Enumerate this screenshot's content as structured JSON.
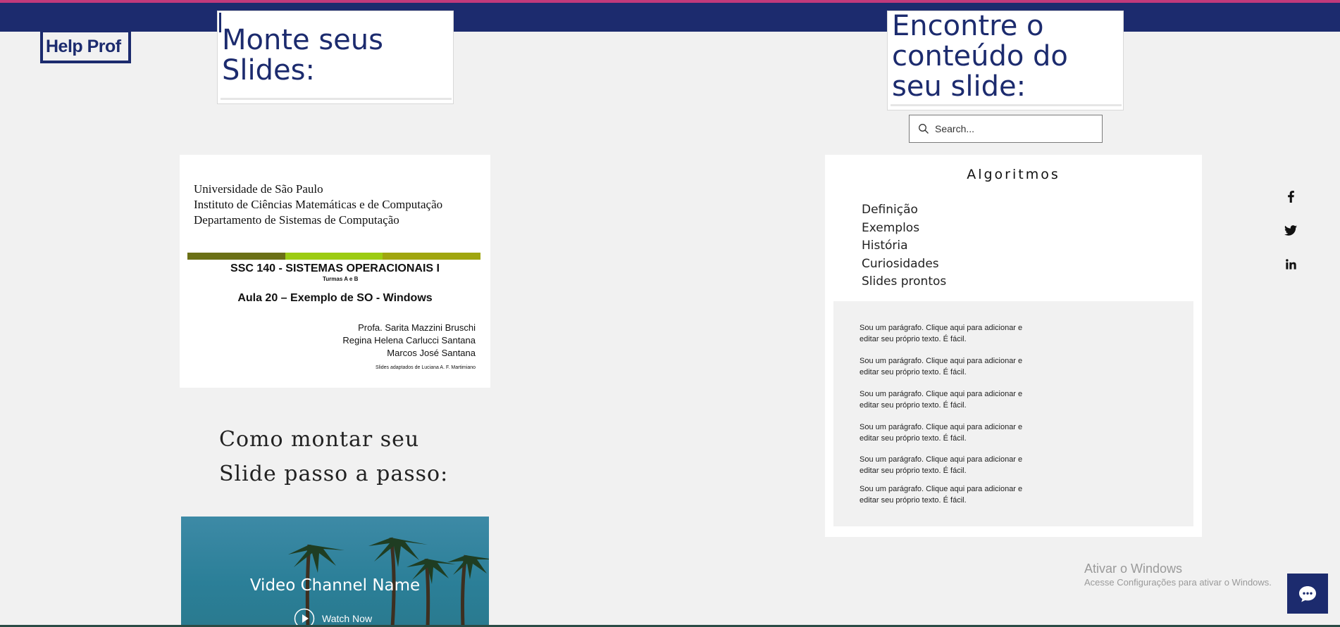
{
  "colors": {
    "brand_navy": "#1c2b6e",
    "accent_pink": "#c13a7b",
    "page_bg": "#f1f1f1"
  },
  "header": {
    "logo_text": "Help Prof"
  },
  "left_title": {
    "text": "Monte seus Slides:"
  },
  "right_title": {
    "text": "Encontre o conteúdo do seu slide:"
  },
  "search": {
    "placeholder": "Search...",
    "icon": "search-icon"
  },
  "slide": {
    "institution_lines": [
      "Universidade de São Paulo",
      "Instituto de Ciências Matemáticas e de Computação",
      "Departamento de Sistemas de Computação"
    ],
    "bar_colors": [
      "#6b7016",
      "#9ccc12",
      "#a0a60f"
    ],
    "course": "SSC 140  - SISTEMAS OPERACIONAIS I",
    "turmas": "Turmas A e B",
    "lecture": "Aula 20 – Exemplo de SO - Windows",
    "authors": [
      "Profa. Sarita Mazzini Bruschi",
      "Regina Helena Carlucci Santana",
      "Marcos José Santana"
    ],
    "adapted": "Slides adaptados de Luciana A. F. Martimiano"
  },
  "howto": {
    "line1": "Como montar seu",
    "line2": "Slide passo a passo:"
  },
  "video": {
    "channel_name": "Video Channel Name",
    "watch_label": "Watch Now",
    "icon": "play-icon"
  },
  "algoritmos": {
    "title": "Algoritmos",
    "items": [
      "Definição",
      "Exemplos",
      "História",
      "Curiosidades",
      "Slides prontos"
    ],
    "paragraphs": [
      "Sou um parágrafo. Clique aqui para adicionar e editar seu próprio texto. É fácil.",
      "Sou um parágrafo. Clique aqui para adicionar e editar seu próprio texto. É fácil.",
      "Sou um parágrafo. Clique aqui para adicionar e editar seu próprio texto. É fácil.",
      "Sou um parágrafo. Clique aqui para adicionar e editar seu próprio texto. É fácil.",
      "Sou um parágrafo. Clique aqui para adicionar e editar seu próprio texto. É fácil.",
      "Sou um parágrafo. Clique aqui para adicionar e editar seu próprio texto. É fácil."
    ]
  },
  "social": [
    "facebook-icon",
    "twitter-icon",
    "linkedin-icon"
  ],
  "windows_watermark": {
    "title": "Ativar o Windows",
    "subtitle": "Acesse Configurações para ativar o Windows."
  },
  "chat": {
    "icon": "chat-icon"
  }
}
